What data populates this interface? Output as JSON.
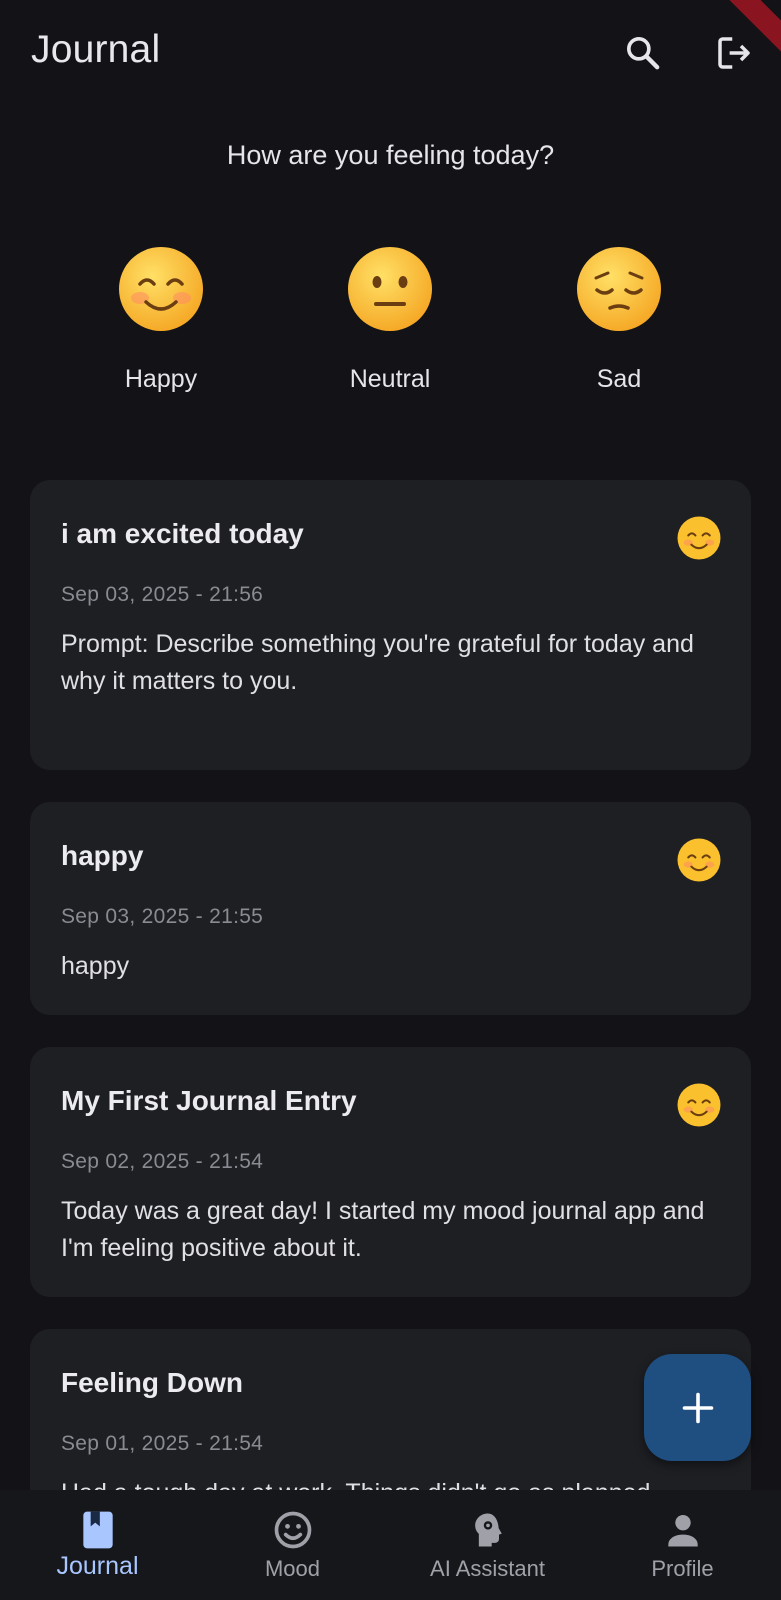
{
  "app_bar": {
    "title": "Journal",
    "search_icon": "search-icon",
    "logout_icon": "logout-icon"
  },
  "mood_picker": {
    "heading": "How are you feeling today?",
    "options": [
      {
        "label": "Happy",
        "icon": "smiling-face-icon"
      },
      {
        "label": "Neutral",
        "icon": "neutral-face-icon"
      },
      {
        "label": "Sad",
        "icon": "pensive-face-icon"
      }
    ]
  },
  "entries": [
    {
      "title": "i am excited today",
      "date": "Sep 03, 2025 - 21:56",
      "body": "Prompt: Describe something you're grateful for today and why it matters to you.",
      "mood_icon": "smiling-face-icon"
    },
    {
      "title": "happy",
      "date": "Sep 03, 2025 - 21:55",
      "body": "happy",
      "mood_icon": "smiling-face-icon"
    },
    {
      "title": "My First Journal Entry",
      "date": "Sep 02, 2025 - 21:54",
      "body": "Today was a great day! I started my mood journal app and I'm feeling positive about it.",
      "mood_icon": "smiling-face-icon"
    },
    {
      "title": "Feeling Down",
      "date": "Sep 01, 2025 - 21:54",
      "body": "Had a tough day at work. Things didn't go as planned.",
      "mood_icon": "pensive-face-icon"
    }
  ],
  "fab": {
    "icon": "plus-icon"
  },
  "bottom_nav": {
    "items": [
      {
        "label": "Journal",
        "icon": "book-icon",
        "active": true
      },
      {
        "label": "Mood",
        "icon": "smiley-outline-icon",
        "active": false
      },
      {
        "label": "AI Assistant",
        "icon": "brain-gear-icon",
        "active": false
      },
      {
        "label": "Profile",
        "icon": "person-icon",
        "active": false
      }
    ]
  },
  "colors": {
    "background": "#131317",
    "card": "#1e1f23",
    "accent": "#a9c6ff",
    "fab": "#1f4e80",
    "debug_banner": "#8a1520"
  }
}
